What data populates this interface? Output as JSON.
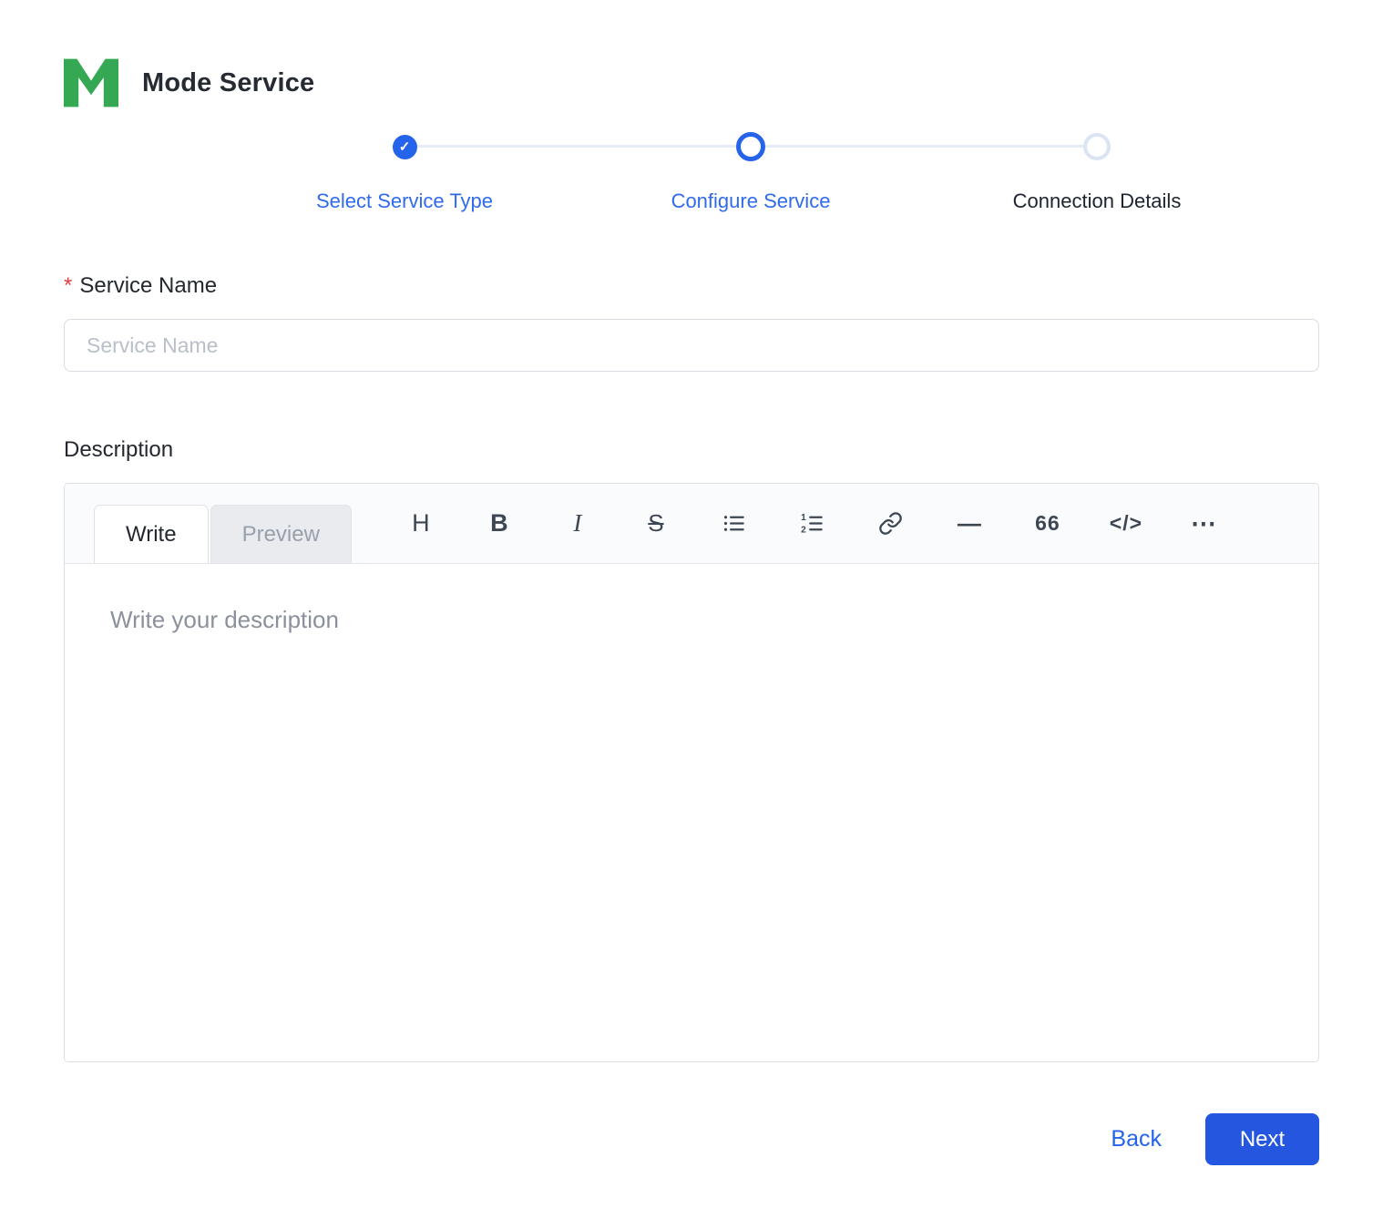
{
  "header": {
    "title": "Mode Service",
    "logo_icon": "mode-logo"
  },
  "stepper": {
    "check_glyph": "✓",
    "steps": [
      {
        "label": "Select Service Type",
        "state": "completed"
      },
      {
        "label": "Configure Service",
        "state": "active"
      },
      {
        "label": "Connection Details",
        "state": "upcoming"
      }
    ]
  },
  "form": {
    "service_name": {
      "required_marker": "*",
      "label": "Service Name",
      "placeholder": "Service Name",
      "value": ""
    },
    "description": {
      "label": "Description",
      "editor": {
        "tabs": [
          {
            "label": "Write",
            "active": true
          },
          {
            "label": "Preview",
            "active": false
          }
        ],
        "toolbar_icons": [
          "header-icon",
          "bold-icon",
          "italic-icon",
          "strikethrough-icon",
          "unordered-list-icon",
          "ordered-list-icon",
          "link-icon",
          "horizontal-rule-icon",
          "quote-icon",
          "code-icon",
          "more-icon"
        ],
        "glyphs": {
          "header": "H",
          "bold": "B",
          "italic": "I",
          "strikethrough": "S",
          "horizontal_rule": "—",
          "quote": "66",
          "code": "</>",
          "more": "⋯"
        },
        "placeholder": "Write your description",
        "value": ""
      }
    }
  },
  "footer": {
    "back_label": "Back",
    "next_label": "Next"
  },
  "colors": {
    "accent_blue": "#2563eb",
    "next_button_blue": "#2456e0",
    "logo_green": "#34a853",
    "required_red": "#e0403f",
    "connector_gray": "#e6ecf5"
  }
}
